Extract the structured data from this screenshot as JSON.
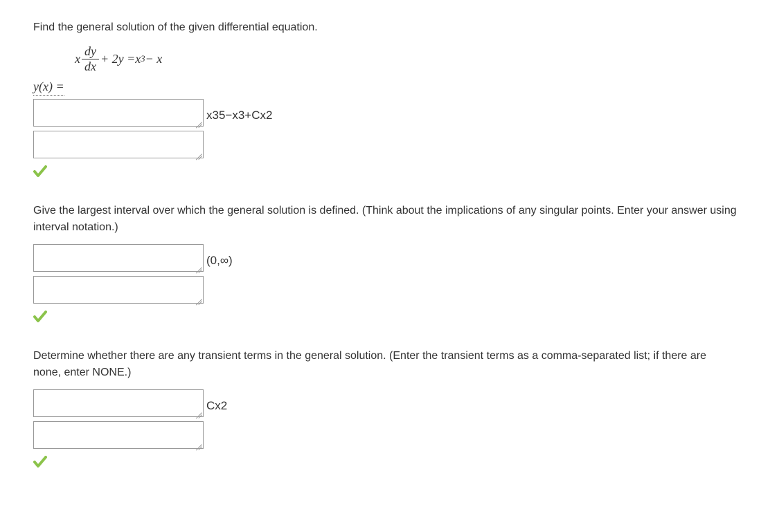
{
  "q1": {
    "prompt": "Find the general solution of the given differential equation.",
    "equation": {
      "lhs_x": "x",
      "frac_num": "dy",
      "frac_den": "dx",
      "plus2y": " + 2y = ",
      "x3": "x",
      "exp": "3",
      "minus_x": " − x"
    },
    "yx_label": "y(x) =",
    "answer": "x35−x3+Cx2"
  },
  "q2": {
    "prompt": "Give the largest interval over which the general solution is defined. (Think about the implications of any singular points. Enter your answer using interval notation.)",
    "answer": "(0,∞)"
  },
  "q3": {
    "prompt": "Determine whether there are any transient terms in the general solution. (Enter the transient terms as a comma-separated list; if there are none, enter NONE.)",
    "answer": "Cx2"
  }
}
